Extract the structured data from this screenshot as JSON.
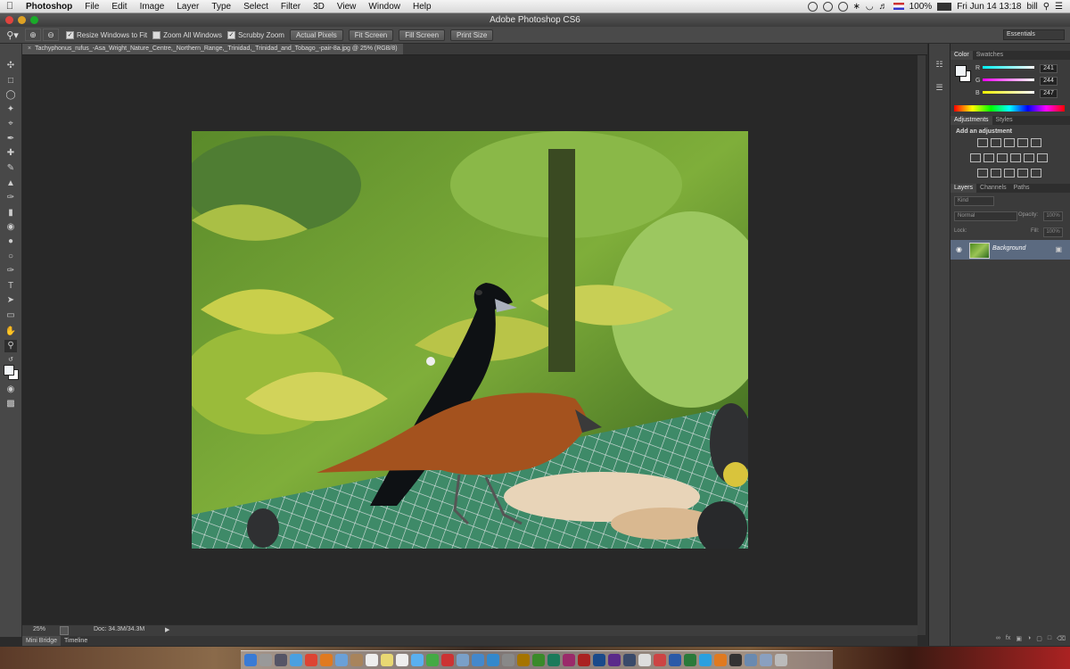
{
  "menubar": {
    "app": "Photoshop",
    "items": [
      "File",
      "Edit",
      "Image",
      "Layer",
      "Type",
      "Select",
      "Filter",
      "3D",
      "View",
      "Window",
      "Help"
    ],
    "battery": "100%",
    "clock": "Fri Jun 14  13:18",
    "user": "bill"
  },
  "window": {
    "title": "Adobe Photoshop CS6"
  },
  "options": {
    "resize_windows": "Resize Windows to Fit",
    "zoom_all": "Zoom All Windows",
    "scrubby": "Scrubby Zoom",
    "actual_pixels": "Actual Pixels",
    "fit_screen": "Fit Screen",
    "fill_screen": "Fill Screen",
    "print_size": "Print Size",
    "workspace": "Essentials"
  },
  "document": {
    "tab_title": "Tachyphonus_rufus_-Asa_Wright_Nature_Centre,_Northern_Range,_Trinidad,_Trinidad_and_Tobago_-pair-8a.jpg @ 25% (RGB/8)"
  },
  "status": {
    "zoom": "25%",
    "doc": "Doc: 34.3M/34.3M"
  },
  "bottom_tabs": [
    "Mini Bridge",
    "Timeline"
  ],
  "color_panel": {
    "tabs": [
      "Color",
      "Swatches"
    ],
    "channels": [
      {
        "label": "R",
        "value": "241"
      },
      {
        "label": "G",
        "value": "244"
      },
      {
        "label": "B",
        "value": "247"
      }
    ]
  },
  "adjustments_panel": {
    "tabs": [
      "Adjustments",
      "Styles"
    ],
    "heading": "Add an adjustment"
  },
  "layers_panel": {
    "tabs": [
      "Layers",
      "Channels",
      "Paths"
    ],
    "kind": "Kind",
    "blend": "Normal",
    "opacity_label": "Opacity:",
    "opacity": "100%",
    "lock_label": "Lock:",
    "fill_label": "Fill:",
    "fill": "100%",
    "layer_name": "Background"
  },
  "colors": {
    "accent_layer": "#5b6a80",
    "menubar": "#e6e6e6",
    "panel": "#3b3b3b"
  }
}
